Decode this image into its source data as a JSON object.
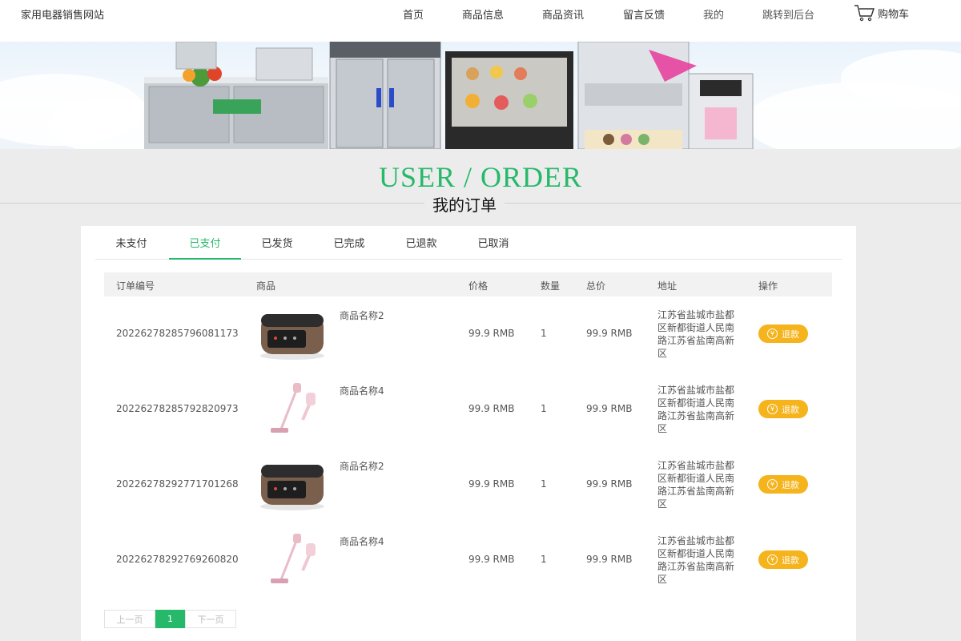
{
  "header": {
    "site_title": "家用电器销售网站",
    "nav": [
      {
        "label": "首页"
      },
      {
        "label": "商品信息"
      },
      {
        "label": "商品资讯"
      },
      {
        "label": "留言反馈"
      },
      {
        "label": "我的"
      },
      {
        "label": "跳转到后台"
      }
    ],
    "cart_label": "购物车",
    "cart_icon": "shopping-cart-icon"
  },
  "title": {
    "en": "USER / ORDER",
    "zh": "我的订单"
  },
  "tabs": [
    {
      "label": "未支付",
      "active": false
    },
    {
      "label": "已支付",
      "active": true
    },
    {
      "label": "已发货",
      "active": false
    },
    {
      "label": "已完成",
      "active": false
    },
    {
      "label": "已退款",
      "active": false
    },
    {
      "label": "已取消",
      "active": false
    }
  ],
  "table": {
    "headers": {
      "order_no": "订单编号",
      "product": "商品",
      "price": "价格",
      "qty": "数量",
      "total": "总价",
      "address": "地址",
      "action": "操作"
    },
    "rows": [
      {
        "order_no": "20226278285796081173",
        "product": "商品名称2",
        "product_image": "rice-cooker-image",
        "price": "99.9 RMB",
        "qty": "1",
        "total": "99.9 RMB",
        "address": "江苏省盐城市盐都区新都街道人民南路江苏省盐南高新区",
        "action": "退款"
      },
      {
        "order_no": "20226278285792820973",
        "product": "商品名称4",
        "product_image": "vacuum-cleaner-image",
        "price": "99.9 RMB",
        "qty": "1",
        "total": "99.9 RMB",
        "address": "江苏省盐城市盐都区新都街道人民南路江苏省盐南高新区",
        "action": "退款"
      },
      {
        "order_no": "20226278292771701268",
        "product": "商品名称2",
        "product_image": "rice-cooker-image",
        "price": "99.9 RMB",
        "qty": "1",
        "total": "99.9 RMB",
        "address": "江苏省盐城市盐都区新都街道人民南路江苏省盐南高新区",
        "action": "退款"
      },
      {
        "order_no": "20226278292769260820",
        "product": "商品名称4",
        "product_image": "vacuum-cleaner-image",
        "price": "99.9 RMB",
        "qty": "1",
        "total": "99.9 RMB",
        "address": "江苏省盐城市盐都区新都街道人民南路江苏省盐南高新区",
        "action": "退款"
      }
    ]
  },
  "pager": {
    "prev": "上一页",
    "current": "1",
    "next": "下一页"
  },
  "colors": {
    "accent": "#27b96a",
    "refund_button": "#f5b31c"
  }
}
